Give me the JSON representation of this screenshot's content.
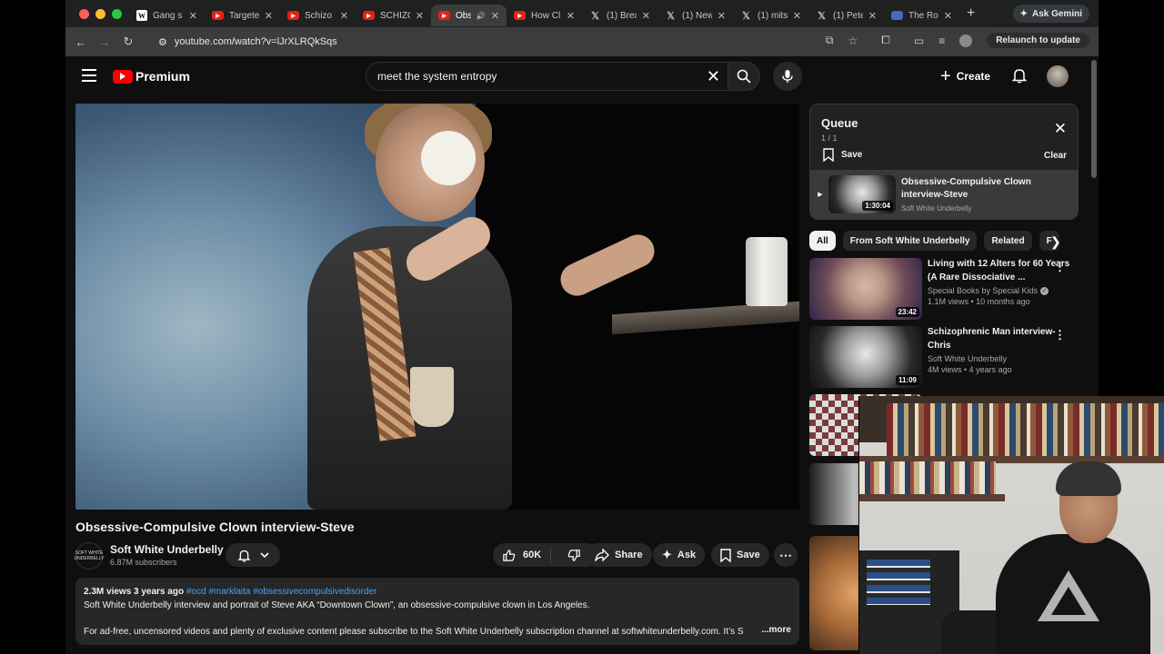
{
  "browser": {
    "tabs": [
      {
        "label": "Gang s",
        "icon": "wikipedia-icon",
        "active": false
      },
      {
        "label": "Targete",
        "icon": "youtube-icon",
        "active": false
      },
      {
        "label": "Schizo",
        "icon": "youtube-icon",
        "active": false
      },
      {
        "label": "SCHIZO",
        "icon": "youtube-icon",
        "active": false
      },
      {
        "label": "Obs",
        "icon": "youtube-icon",
        "active": true
      },
      {
        "label": "How Cl",
        "icon": "youtube-icon",
        "active": false
      },
      {
        "label": "(1) Brea",
        "icon": "x-icon",
        "active": false
      },
      {
        "label": "(1) New",
        "icon": "x-icon",
        "active": false
      },
      {
        "label": "(1) mits",
        "icon": "x-icon",
        "active": false
      },
      {
        "label": "(1) Pete",
        "icon": "x-icon",
        "active": false
      },
      {
        "label": "The Ro",
        "icon": "doc-icon",
        "active": false
      }
    ],
    "gemini_label": "Ask Gemini",
    "url": "youtube.com/watch?v=lJrXLRQkSqs",
    "relaunch_label": "Relaunch to update"
  },
  "youtube": {
    "logo_label": "Premium",
    "search_value": "meet the system entropy",
    "create_label": "Create"
  },
  "video": {
    "title": "Obsessive-Compulsive Clown interview-Steve",
    "channel": "Soft White Underbelly",
    "channel_avatar_text": "SOFT WHITE UNDERBELLY",
    "subscribers": "6.87M subscribers",
    "likes": "60K",
    "share_label": "Share",
    "ask_label": "Ask",
    "save_label": "Save",
    "desc_meta": "2.3M views  3 years ago",
    "desc_tags": "#ocd #marklaita #obsessivecompulsivedisorder",
    "desc_line1": "Soft White Underbelly interview and portrait of Steve AKA “Downtown Clown”, an obsessive-compulsive clown in Los Angeles.",
    "desc_line2": "For ad-free, uncensored videos and plenty of exclusive content please subscribe to the Soft White Underbelly subscription channel at softwhiteunderbelly.com. It’s S",
    "more_label": "...more"
  },
  "queue": {
    "title": "Queue",
    "count": "1 / 1",
    "save_label": "Save",
    "clear_label": "Clear",
    "item": {
      "title": "Obsessive-Compulsive Clown interview-Steve",
      "channel": "Soft White Underbelly",
      "duration": "1:30:04"
    }
  },
  "chips": [
    "All",
    "From Soft White Underbelly",
    "Related",
    "F"
  ],
  "recommendations": [
    {
      "title": "Living with 12 Alters for 60 Years (A Rare Dissociative ...",
      "channel": "Special Books by Special Kids",
      "verified": true,
      "meta": "1.1M views • 10 months ago",
      "duration": "23:42"
    },
    {
      "title": "Schizophrenic Man interview-Chris",
      "channel": "Soft White Underbelly",
      "verified": false,
      "meta": "4M views • 4 years ago",
      "duration": "11:09"
    }
  ],
  "colors": {
    "brand_red": "#ff0000",
    "link_blue": "#3ea6ff",
    "bg": "#0f0f0f",
    "surface": "#272727"
  }
}
